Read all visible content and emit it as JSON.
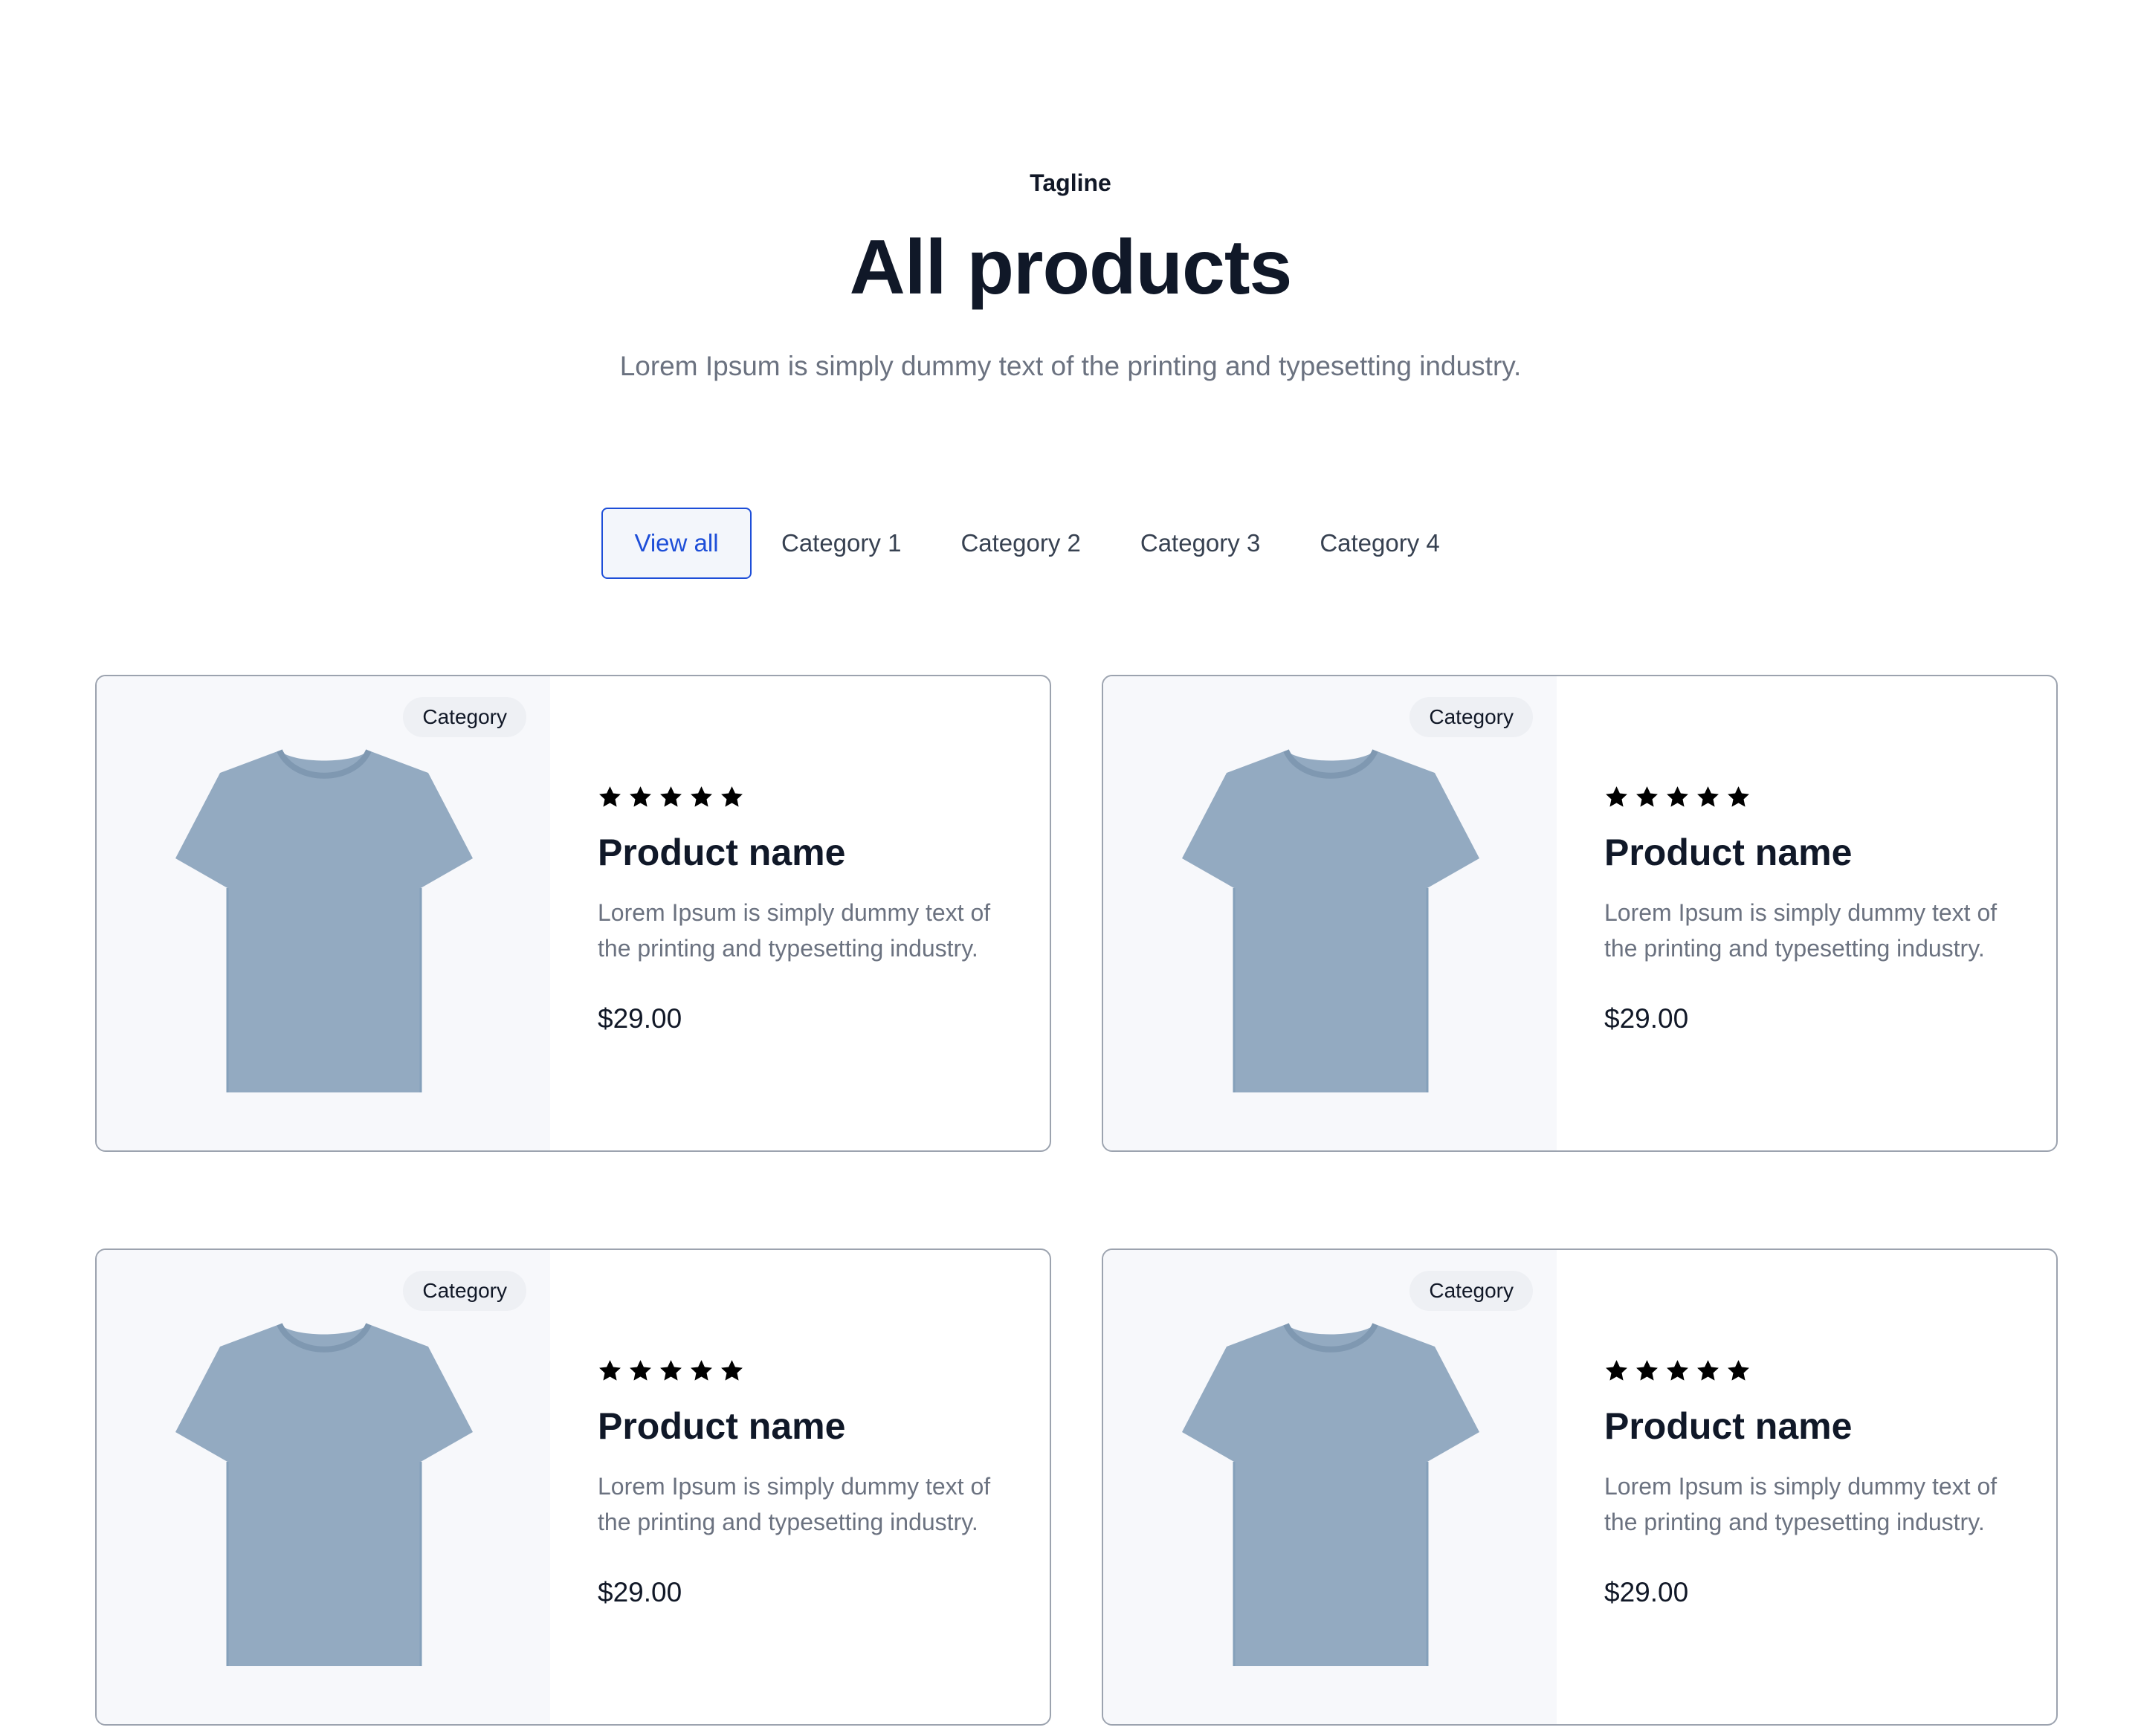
{
  "header": {
    "tagline": "Tagline",
    "title": "All products",
    "subtitle": "Lorem Ipsum is simply dummy text of the printing and typesetting industry."
  },
  "tabs": [
    {
      "label": "View all",
      "active": true
    },
    {
      "label": "Category 1",
      "active": false
    },
    {
      "label": "Category 2",
      "active": false
    },
    {
      "label": "Category 3",
      "active": false
    },
    {
      "label": "Category 4",
      "active": false
    }
  ],
  "products": [
    {
      "badge": "Category",
      "rating": 5,
      "name": "Product name",
      "description": "Lorem Ipsum is simply dummy text of the printing and typesetting industry.",
      "price": "$29.00",
      "image_icon": "tshirt-image"
    },
    {
      "badge": "Category",
      "rating": 5,
      "name": "Product name",
      "description": "Lorem Ipsum is simply dummy text of the printing and typesetting industry.",
      "price": "$29.00",
      "image_icon": "tshirt-image"
    },
    {
      "badge": "Category",
      "rating": 5,
      "name": "Product name",
      "description": "Lorem Ipsum is simply dummy text of the printing and typesetting industry.",
      "price": "$29.00",
      "image_icon": "tshirt-image"
    },
    {
      "badge": "Category",
      "rating": 5,
      "name": "Product name",
      "description": "Lorem Ipsum is simply dummy text of the printing and typesetting industry.",
      "price": "$29.00",
      "image_icon": "tshirt-image"
    }
  ],
  "colors": {
    "accent": "#1d4ed8",
    "tshirt": "#93aac1",
    "card_border": "#9ca3af"
  }
}
